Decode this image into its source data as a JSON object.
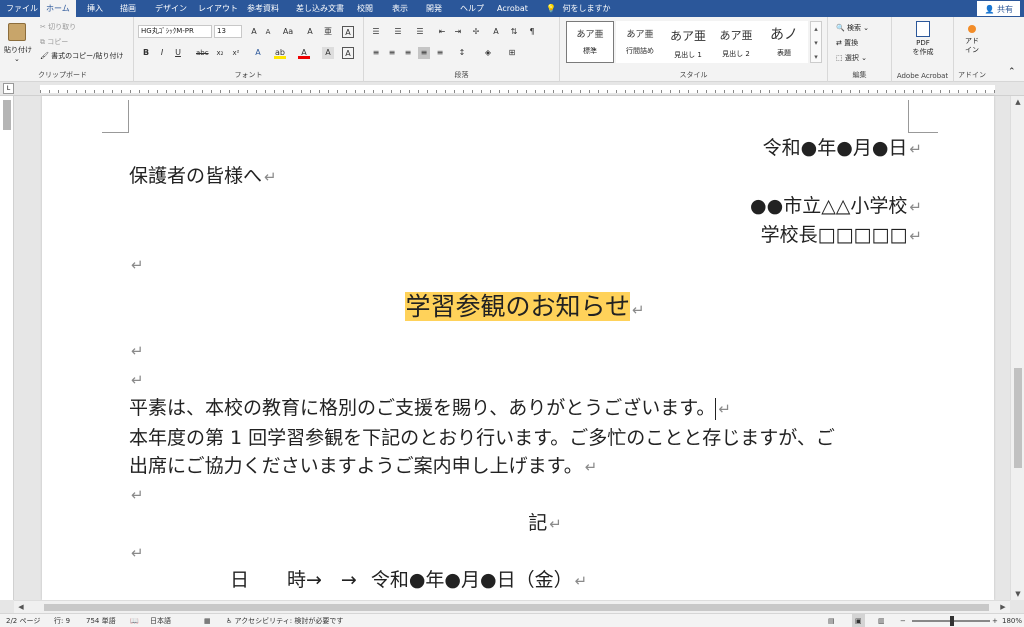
{
  "tabs": [
    "ファイル",
    "ホーム",
    "挿入",
    "描画",
    "デザイン",
    "レイアウト",
    "参考資料",
    "差し込み文書",
    "校閲",
    "表示",
    "開発",
    "ヘルプ",
    "Acrobat"
  ],
  "active_tab": "ホーム",
  "tell_me": "何をしますか",
  "share": "共有",
  "clipboard": {
    "paste": "貼り付け",
    "cut": "切り取り",
    "copy": "コピー",
    "format_painter": "書式のコピー/貼り付け",
    "label": "クリップボード"
  },
  "font": {
    "name": "HG丸ｺﾞｼｯｸM-PR",
    "size": "13",
    "label": "フォント"
  },
  "paragraph": {
    "label": "段落"
  },
  "styles": {
    "label": "スタイル",
    "items": [
      {
        "sample": "あア亜",
        "name": "標準"
      },
      {
        "sample": "あア亜",
        "name": "行間詰め"
      },
      {
        "sample": "あア亜",
        "name": "見出し 1"
      },
      {
        "sample": "あア亜",
        "name": "見出し 2"
      },
      {
        "sample": "あノ",
        "name": "表題"
      }
    ]
  },
  "editing": {
    "label": "編集",
    "find": "検索",
    "replace": "置換",
    "select": "選択"
  },
  "acrobat": {
    "button": "PDF\nを作成",
    "label": "Adobe Acrobat"
  },
  "addin": {
    "button": "アド\nイン",
    "label": "アドイン"
  },
  "document": {
    "date": "令和●年●月●日",
    "addressee": "保護者の皆様へ",
    "school": "●●市立△△小学校",
    "principal": "学校長□□□□□",
    "title": "学習参観のお知らせ",
    "para1": "平素は、本校の教育に格別のご支援を賜り、ありがとうございます。",
    "para2a": "本年度の第 1 回学習参観を下記のとおり行います。ご多忙のことと存じますが、ご",
    "para2b": "出席にご協力くださいますようご案内申し上げます。",
    "ki": "記",
    "schedule_label": "日　　時→　→",
    "schedule_value": "令和●年●月●日（金）"
  },
  "status_bar": {
    "page": "2/2 ページ",
    "line": "行: 9",
    "words": "754 単語",
    "language": "日本語",
    "accessibility": "アクセシビリティ: 検討が必要です",
    "zoom": "180%"
  }
}
